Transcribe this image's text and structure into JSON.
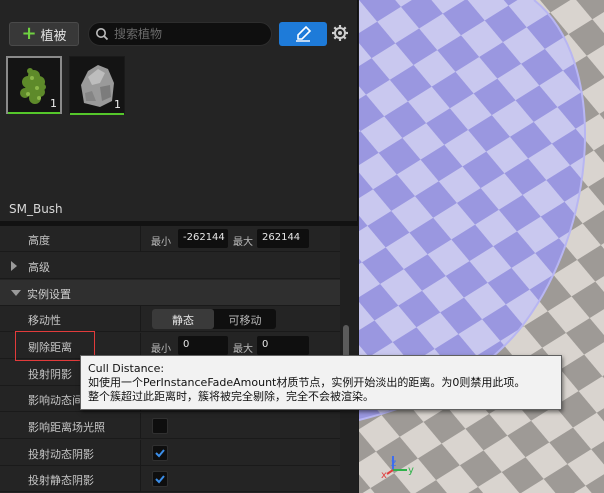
{
  "toolbar": {
    "add_label": "植被",
    "search_placeholder": "搜索植物"
  },
  "foliage": [
    {
      "name": "bush",
      "count": "1"
    },
    {
      "name": "rock",
      "count": "1"
    }
  ],
  "mesh_name": "SM_Bush",
  "properties": {
    "height": {
      "label": "高度",
      "min_label": "最小",
      "min_value": "-262144",
      "max_label": "最大",
      "max_value": "262144"
    },
    "advanced": {
      "label": "高级"
    },
    "instance_settings": {
      "label": "实例设置"
    },
    "mobility": {
      "label": "移动性",
      "static": "静态",
      "movable": "可移动"
    },
    "cull_distance": {
      "label": "剔除距离",
      "min_label": "最小",
      "min_value": "0",
      "max_label": "最大",
      "max_value": "0"
    },
    "cast_shadow": {
      "label": "投射阴影"
    },
    "affect_dynamic_gi": {
      "label": "影响动态间接光照"
    },
    "affect_distance_field": {
      "label": "影响距离场光照"
    },
    "cast_dynamic_shadow": {
      "label": "投射动态阴影"
    },
    "cast_static_shadow": {
      "label": "投射静态阴影"
    }
  },
  "tooltip": {
    "title": "Cull Distance:",
    "line1": "如使用一个PerInstanceFadeAmount材质节点，实例开始淡出的距离。为0则禁用此项。",
    "line2": "整个簇超过此距离时，簇将被完全剔除，完全不会被渲染。"
  },
  "viewport": {
    "axis_x": "x",
    "axis_y": "y",
    "axis_z": "z"
  },
  "colors": {
    "accent": "#1e7bd9",
    "add_green": "#6fd141",
    "highlight": "#e23b3b"
  }
}
